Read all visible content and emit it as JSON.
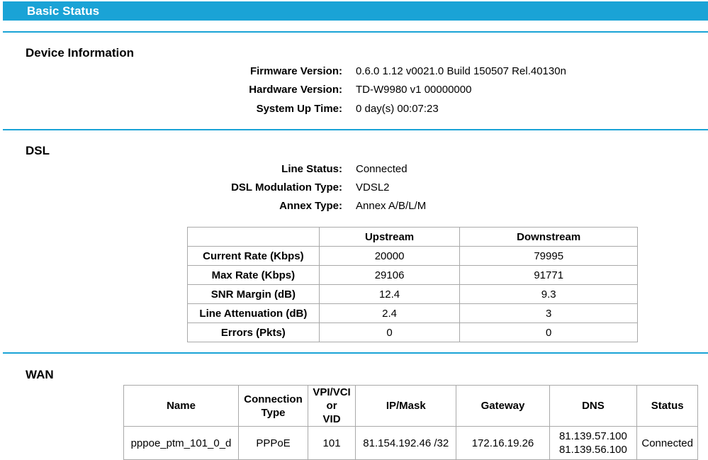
{
  "page": {
    "title": "Basic Status"
  },
  "device_info": {
    "title": "Device Information",
    "rows": [
      {
        "label": "Firmware Version:",
        "value": "0.6.0 1.12 v0021.0 Build 150507 Rel.40130n"
      },
      {
        "label": "Hardware Version:",
        "value": "TD-W9980 v1 00000000"
      },
      {
        "label": "System Up Time:",
        "value": "0 day(s) 00:07:23"
      }
    ]
  },
  "dsl": {
    "title": "DSL",
    "rows": [
      {
        "label": "Line Status:",
        "value": "Connected"
      },
      {
        "label": "DSL Modulation Type:",
        "value": "VDSL2"
      },
      {
        "label": "Annex Type:",
        "value": "Annex A/B/L/M"
      }
    ],
    "table": {
      "headers": [
        "",
        "Upstream",
        "Downstream"
      ],
      "rows": [
        {
          "label": "Current Rate (Kbps)",
          "up": "20000",
          "down": "79995"
        },
        {
          "label": "Max Rate (Kbps)",
          "up": "29106",
          "down": "91771"
        },
        {
          "label": "SNR Margin (dB)",
          "up": "12.4",
          "down": "9.3"
        },
        {
          "label": "Line Attenuation (dB)",
          "up": "2.4",
          "down": "3"
        },
        {
          "label": "Errors (Pkts)",
          "up": "0",
          "down": "0"
        }
      ]
    }
  },
  "wan": {
    "title": "WAN",
    "headers": {
      "name": "Name",
      "conn_line1": "Connection",
      "conn_line2": "Type",
      "vpi_line1": "VPI/VCI or",
      "vpi_line2": "VID",
      "ipmask": "IP/Mask",
      "gateway": "Gateway",
      "dns": "DNS",
      "status": "Status"
    },
    "row": {
      "name": "pppoe_ptm_101_0_d",
      "type": "PPPoE",
      "vid": "101",
      "ipmask": "81.154.192.46 /32",
      "gateway": "172.16.19.26",
      "dns1": "81.139.57.100",
      "dns2": "81.139.56.100",
      "status": "Connected"
    }
  }
}
